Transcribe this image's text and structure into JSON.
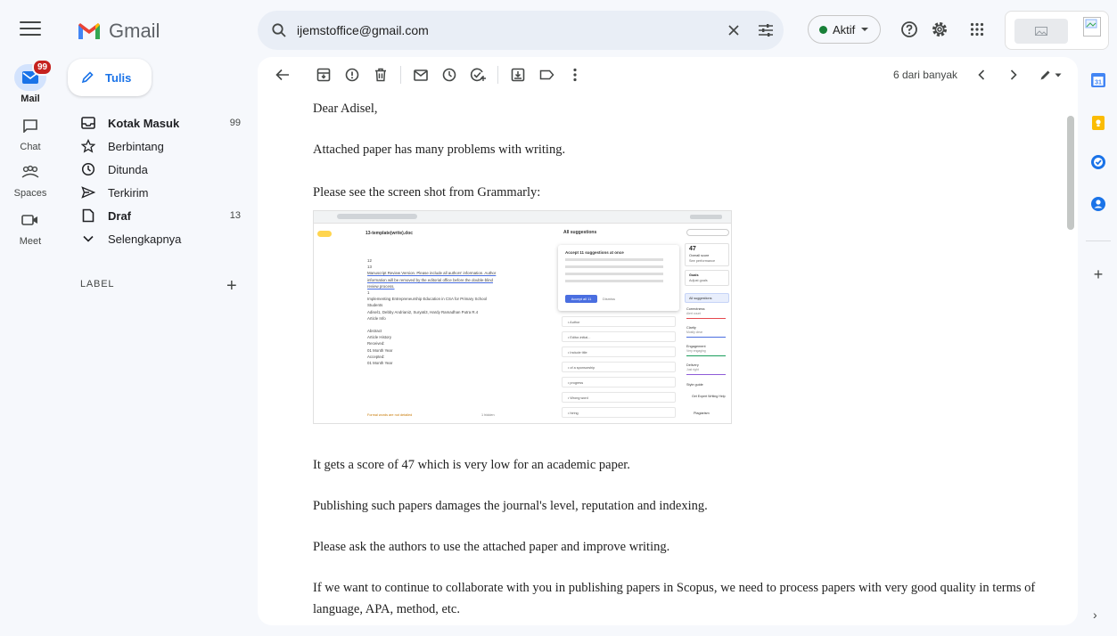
{
  "app": {
    "name": "Gmail"
  },
  "rail": {
    "items": [
      {
        "label": "Mail",
        "badge": "99"
      },
      {
        "label": "Chat"
      },
      {
        "label": "Spaces"
      },
      {
        "label": "Meet"
      }
    ]
  },
  "compose": {
    "label": "Tulis"
  },
  "nav": {
    "items": [
      {
        "label": "Kotak Masuk",
        "count": "99"
      },
      {
        "label": "Berbintang"
      },
      {
        "label": "Ditunda"
      },
      {
        "label": "Terkirim"
      },
      {
        "label": "Draf",
        "count": "13"
      },
      {
        "label": "Selengkapnya"
      }
    ],
    "labels_heading": "LABEL"
  },
  "search": {
    "value": "ijemstoffice@gmail.com"
  },
  "status": {
    "label": "Aktif"
  },
  "pager": {
    "text": "6 dari banyak"
  },
  "email": {
    "greeting": "Dear Adisel,",
    "paragraphs": [
      "Attached paper has many problems with writing.",
      "Please see the screen shot from Grammarly:",
      "It gets a score of 47 which is very low for an academic paper.",
      "Publishing such papers damages the journal's level, reputation and indexing.",
      "Please ask the authors to use the attached paper and improve writing.",
      "If we want to continue to collaborate with you in publishing papers in Scopus, we need to process papers with very good quality in terms of language, APA, method, etc."
    ]
  },
  "grammarly": {
    "doc_title": "13-template(write).doc",
    "suggestions_header": "All suggestions",
    "accept_all_title": "Accept 11 suggestions at once",
    "accept_button": "Accept all 11",
    "dismiss": "Dismiss",
    "score": "47",
    "score_label": "Overall score",
    "score_link": "See performance",
    "goals_label": "Goals",
    "goals_value": "Adjust goals",
    "all_suggestions_tab": "All suggestions",
    "categories": [
      {
        "name": "Correctness",
        "value": "Alert count",
        "color": "#e5484d"
      },
      {
        "name": "Clarity",
        "value": "Mostly clear",
        "color": "#4a6ee0"
      },
      {
        "name": "Engagement",
        "value": "Very engaging",
        "color": "#1a9e5c"
      },
      {
        "name": "Delivery",
        "value": "Just right",
        "color": "#8e5bd8"
      }
    ],
    "style_guide": "Style guide",
    "expert_help": "Get Expert Writing Help",
    "plagiarism": "Plagiarism",
    "doc_lines": [
      "12",
      "13",
      "Manuscript Review Version. Please include all authors' information. Author",
      "information will be removed by the editorial office before the double-blind",
      "review process.",
      "1",
      "Implementing Entrepreneurship Education in CSA for Primary School",
      "Students",
      "Adisel1, Debby Andriani2, Suryati3, Hardy Ramadhan Putra R.4",
      "Article Info",
      "",
      "Abstract",
      "Article History",
      "Received:",
      "01 Month Year",
      "Accepted:",
      "01 Month Year"
    ],
    "suggestion_rows": [
      "Author",
      "Editor-initial...",
      "Include title",
      "of a sponsorship",
      "progress",
      "Wrong word",
      "hiring"
    ],
    "bottom_warning": "Formal words are not detailed",
    "bottom_dropdown": "1 hidden"
  }
}
